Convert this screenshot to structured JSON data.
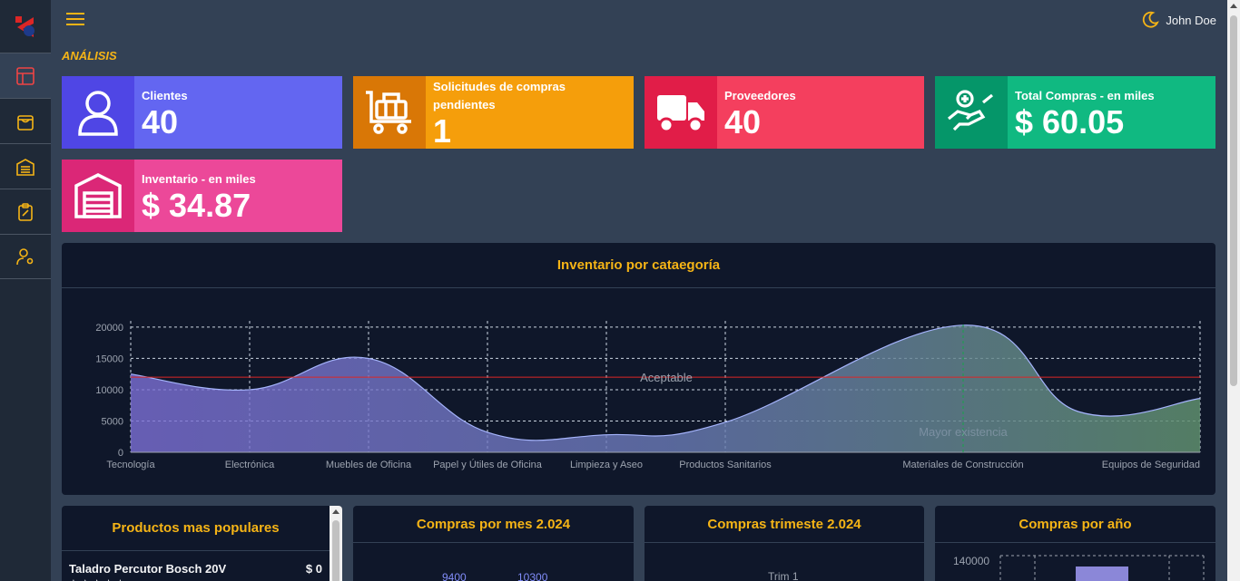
{
  "header": {
    "user_name": "John Doe"
  },
  "section_title": "ANÁLISIS",
  "kpis": [
    {
      "label": "Clientes",
      "value": "40",
      "color": "#6366f1",
      "icon_bg": "#4f46e5",
      "icon": "user-icon"
    },
    {
      "label": "Solicitudes de compras pendientes",
      "value": "1",
      "color": "#f59e0b",
      "icon_bg": "#d97706",
      "icon": "cart-icon"
    },
    {
      "label": "Proveedores",
      "value": "40",
      "color": "#f43f5e",
      "icon_bg": "#e11d48",
      "icon": "truck-icon"
    },
    {
      "label": "Total Compras - en miles",
      "value": "$ 60.05",
      "color": "#10b981",
      "icon_bg": "#059669",
      "icon": "hand-money-icon"
    },
    {
      "label": "Inventario - en miles",
      "value": "$ 34.87",
      "color": "#ec4899",
      "icon_bg": "#db2777",
      "icon": "warehouse-icon"
    }
  ],
  "inventory_chart": {
    "title": "Inventario por cataegoría",
    "chart_data": {
      "type": "area",
      "categories": [
        "Tecnología",
        "Electrónica",
        "Muebles de Oficina",
        "Papel y Útiles de Oficina",
        "Limpieza y Aseo",
        "Productos Sanitarios",
        "Materiales de Construcción",
        "Equipos de Seguridad"
      ],
      "series": [
        {
          "values": [
            12500,
            10000,
            15000,
            3200,
            2800,
            4800,
            20300,
            6500,
            8600
          ]
        }
      ],
      "yticks": [
        0,
        5000,
        10000,
        15000,
        20000
      ],
      "ylim": [
        0,
        21000
      ],
      "annotations": [
        {
          "type": "hline",
          "y": 12000,
          "label": "Aceptable",
          "color": "#dc2626"
        },
        {
          "type": "vline",
          "label": "Mayor existencia",
          "color": "#16a34a"
        }
      ],
      "grid": true
    }
  },
  "bottom_panels": {
    "popular": {
      "title": "Productos mas populares",
      "items": [
        {
          "name": "Taladro Percutor Bosch 20V",
          "price": "$ 0",
          "stars": "★★★★★"
        }
      ]
    },
    "monthly": {
      "title": "Compras por mes 2.024",
      "values": [
        "9400",
        "10300"
      ]
    },
    "quarterly": {
      "title": "Compras trimeste 2.024",
      "label": "Trim 1"
    },
    "yearly": {
      "title": "Compras por año",
      "tick": "140000"
    }
  }
}
